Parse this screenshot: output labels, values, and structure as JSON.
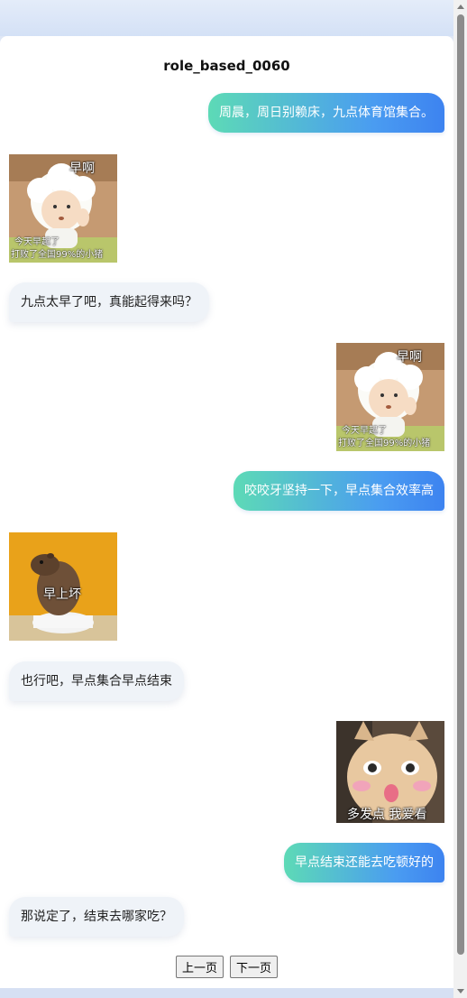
{
  "title": "role_based_0060",
  "messages": {
    "m1": "周晨，周日别赖床，九点体育馆集合。",
    "m2": "九点太早了吧，真能起得来吗？",
    "m3": "咬咬牙坚持一下，早点集合效率高",
    "m4": "也行吧，早点集合早点结束",
    "m5": "早点结束还能去吃顿好的",
    "m6": "那说定了，结束去哪家吃？"
  },
  "stickers": {
    "s1": {
      "top": "早啊",
      "line1": "今天早起了",
      "line2": "打败了全国99%的小猪"
    },
    "s2": {
      "top": "早啊",
      "line1": "今天早起了",
      "line2": "打败了全国99%的小猪"
    },
    "s3": {
      "caption": "早上坏"
    },
    "s4": {
      "caption": "多发点 我爱看"
    }
  },
  "pager": {
    "prev": "上一页",
    "next": "下一页"
  },
  "colors": {
    "bubble_right_start": "#5ddab6",
    "bubble_right_end": "#3d83f0",
    "bubble_left": "#eff3f8"
  }
}
